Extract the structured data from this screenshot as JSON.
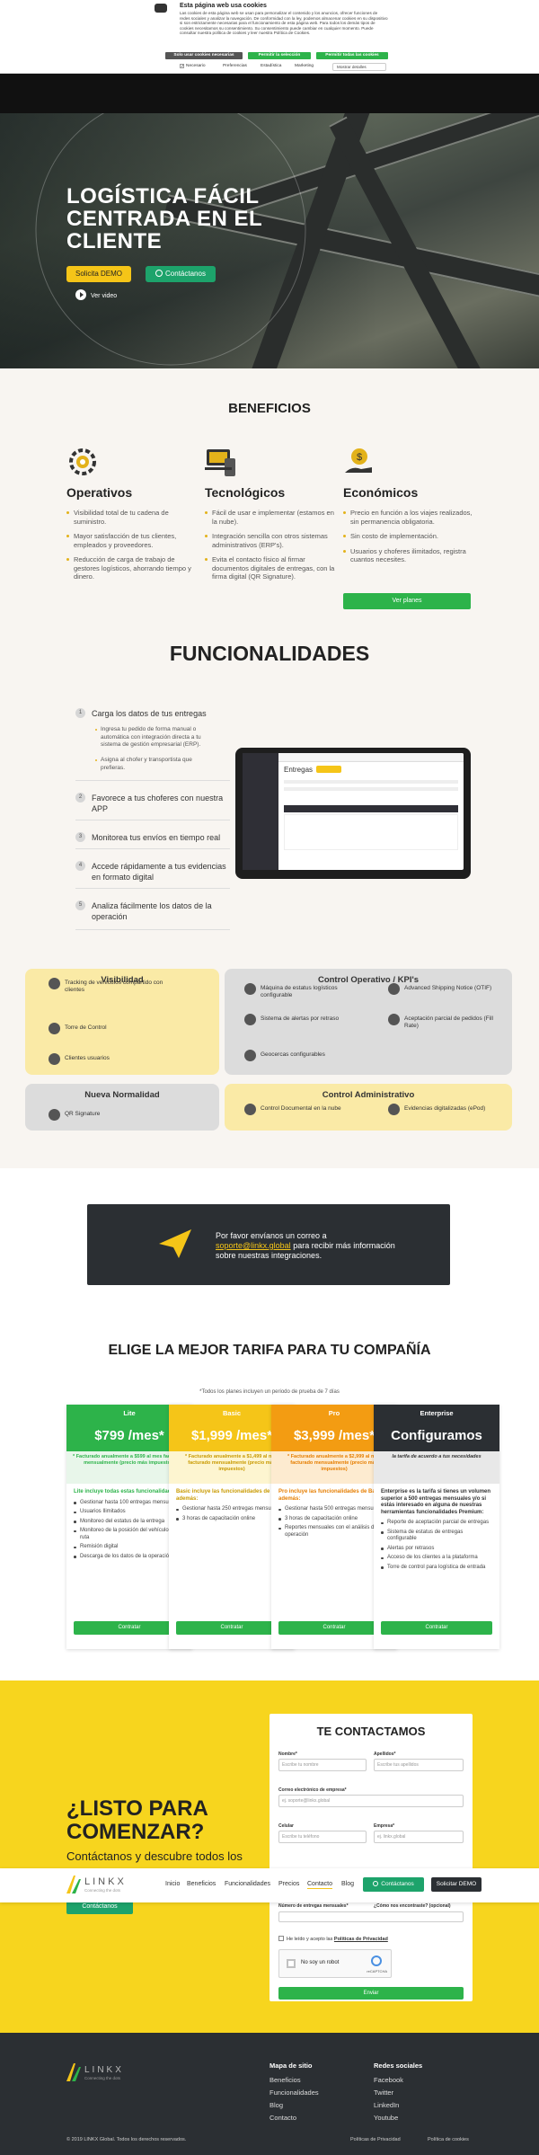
{
  "cookie_banner": {
    "title": "Esta página web usa cookies",
    "body": "Las cookies de esta página web se usan para personalizar el contenido y los anuncios, ofrecer funciones de redes sociales y analizar la navegación. De conformidad con la ley, podemos almacenar cookies en su dispositivo si son estrictamente necesarias para el funcionamiento de esta página web. Para todos los demás tipos de cookies necesitamos su consentimiento. Su consentimiento puede cambiar en cualquier momento. Puede consultar nuestra política de cookies y leer nuestra Política de Cookies.",
    "btn_necessary": "Solo usar cookies necesarias",
    "btn_selection": "Permitir la selección",
    "btn_all": "Permitir todas las cookies",
    "tabs": [
      "Necesario",
      "Preferencias",
      "Estadística",
      "Marketing"
    ],
    "details": "Mostrar detalles"
  },
  "hero": {
    "title": "LOGÍSTICA FÁCIL CENTRADA EN EL CLIENTE",
    "btn_demo": "Solicita DEMO",
    "btn_contact": "Contáctanos",
    "video": "Ver video"
  },
  "benefits": {
    "heading": "BENEFICIOS",
    "cols": [
      {
        "title": "Operativos",
        "items": [
          "Visibilidad total de tu cadena de suministro.",
          "Mayor satisfacción de tus clientes, empleados y proveedores.",
          "Reducción de carga de trabajo de gestores logísticos, ahorrando tiempo y dinero."
        ]
      },
      {
        "title": "Tecnológicos",
        "items": [
          "Fácil de usar e implementar (estamos en la nube).",
          "Integración sencilla con otros sistemas administrativos (ERP's).",
          "Evita el contacto físico al firmar documentos digitales de entregas, con la firma digital (QR Signature)."
        ]
      },
      {
        "title": "Económicos",
        "items": [
          "Precio en función a los viajes realizados, sin permanencia obligatoria.",
          "Sin costo de implementación.",
          "Usuarios y choferes ilimitados, registra cuantos necesites."
        ]
      }
    ],
    "cta": "Ver planes"
  },
  "func": {
    "heading": "FUNCIONALIDADES",
    "items": [
      {
        "num": "1",
        "label": "Carga los datos de tus entregas"
      },
      {
        "num": "2",
        "label": "Favorece a tus choferes con nuestra APP"
      },
      {
        "num": "3",
        "label": "Monitorea tus envíos en tiempo real"
      },
      {
        "num": "4",
        "label": "Accede rápidamente a tus evidencias en formato digital"
      },
      {
        "num": "5",
        "label": "Analiza fácilmente los datos de la operación"
      }
    ],
    "subs": [
      "Ingresa tu pedido de forma manual o automática con integración directa a tu sistema de gestión empresarial (ERP).",
      "Asigna al chofer y transportista que prefieras."
    ],
    "screen_title": "Entregas"
  },
  "cards": {
    "visibilidad": {
      "title": "Visibilidad",
      "items": [
        "Tracking de vehículos compartido con clientes",
        "Torre de Control",
        "Clientes usuarios"
      ]
    },
    "control": {
      "title": "Control Operativo / KPI's",
      "items": [
        "Máquina de estatus logísticos configurable",
        "Sistema de alertas por retraso",
        "Geocercas configurables",
        "Advanced Shipping Notice (OTIF)",
        "Aceptación parcial de pedidos (Fill Rate)"
      ]
    },
    "normalidad": {
      "title": "Nueva Normalidad",
      "items": [
        "QR Signature"
      ]
    },
    "admin": {
      "title": "Control Administrativo",
      "items": [
        "Control Documental en la nube",
        "Evidencias digitalizadas (ePod)"
      ]
    }
  },
  "email_band": {
    "pre": "Por favor envíanos un correo a",
    "email": "soporte@linkx.global",
    "post": "para recibir más información sobre nuestras integraciones."
  },
  "pricing": {
    "heading": "ELIGE LA MEJOR TARIFA PARA TU COMPAÑÍA",
    "note": "*Todos los planes incluyen un periodo de prueba de 7 días",
    "plans": [
      {
        "name": "Lite",
        "price": "$799 /mes*",
        "note": "* Facturado anualmente a $599 al mes facturado mensualmente (precio más impuestos)",
        "title": "Lite incluye todas estas funcionalidades",
        "items": [
          "Gestionar hasta 100 entregas mensuales",
          "Usuarios Ilimitados",
          "Monitoreo del estatus de la entrega",
          "Monitoreo de la posición del vehículo en ruta",
          "Remisión digital",
          "Descarga de los datos de la operación"
        ],
        "btn": "Contratar",
        "color": "#2db34a"
      },
      {
        "name": "Basic",
        "price": "$1,999 /mes*",
        "note": "* Facturado anualmente a $1,499 al mes facturado mensualmente (precio más impuestos)",
        "title": "Basic incluye las funcionalidades de Lite y además:",
        "items": [
          "Gestionar hasta 250 entregas mensuales",
          "3 horas de capacitación online"
        ],
        "btn": "Contratar",
        "color": "#f5c518"
      },
      {
        "name": "Pro",
        "price": "$3,999 /mes*",
        "note": "* Facturado anualmente a $2,999 al mes facturado mensualmente (precio más impuestos)",
        "title": "Pro incluye las funcionalidades de Basic y además:",
        "items": [
          "Gestionar hasta 500 entregas mensuales",
          "3 horas de capacitación online",
          "Reportes mensuales con el análisis de la operación"
        ],
        "btn": "Contratar",
        "color": "#f39c12"
      },
      {
        "name": "Enterprise",
        "price": "Configuramos",
        "note": "la tarifa de acuerdo a tus necesidades",
        "title": "Enterprise es la tarifa si tienes un volumen superior a 500 entregas mensuales y/o si estás interesado en alguna de nuestras herramientas funcionalidades Premium:",
        "items": [
          "Reporte de aceptación parcial de entregas",
          "Sistema de estatus de entregas configurable",
          "Alertas por retrasos",
          "Acceso de los clientes a la plataforma",
          "Torre de control para logística de entrada"
        ],
        "btn": "Contratar",
        "color": "#2b2f33"
      }
    ]
  },
  "contact": {
    "heading": "TE CONTACTAMOS",
    "listo": "¿LISTO PARA COMENZAR?",
    "listo_sub": "Contáctanos y descubre todos los",
    "btn_contact": "Contáctanos",
    "fields": {
      "nombre": "Nombre*",
      "nombre_ph": "Escribe tu nombre",
      "apellidos": "Apellidos*",
      "apellidos_ph": "Escribe tus apellidos",
      "email": "Correo electrónico de empresa*",
      "email_ph": "ej. soporte@linkx.global",
      "celular": "Celular",
      "celular_ph": "Escribe tu teléfono",
      "empresa": "Empresa*",
      "empresa_ph": "ej. linkx.global",
      "entregas": "Número de entregas mensuales*",
      "conocer": "¿Cómo nos encontraste? (opcional)"
    },
    "privacy_pre": "He leído y acepto las",
    "privacy_link": "Políticas de Privacidad",
    "robot": "No soy un robot",
    "captcha": "reCAPTCHA",
    "submit": "Enviar"
  },
  "nav": {
    "logo": "LINKX",
    "tagline": "Connecting the dots",
    "links": [
      "Inicio",
      "Beneficios",
      "Funcionalidades",
      "Precios",
      "Contacto",
      "Blog"
    ],
    "btn_contact": "Contáctanos",
    "btn_demo": "Solicitar DEMO"
  },
  "footer": {
    "logo": "LINKX",
    "tagline": "Connecting the dots",
    "map_title": "Mapa de sitio",
    "map_links": [
      "Beneficios",
      "Funcionalidades",
      "Blog",
      "Contacto"
    ],
    "social_title": "Redes sociales",
    "social_links": [
      "Facebook",
      "Twitter",
      "LinkedIn",
      "Youtube"
    ],
    "copyright": "© 2019 LINKX Global. Todos los derechos reservados.",
    "privacy": "Políticas de Privacidad",
    "cookies": "Política de cookies"
  },
  "colors": {
    "yellow": "#f5c518",
    "green": "#2db34a",
    "dark": "#2b2f33",
    "orange": "#f39c12"
  }
}
